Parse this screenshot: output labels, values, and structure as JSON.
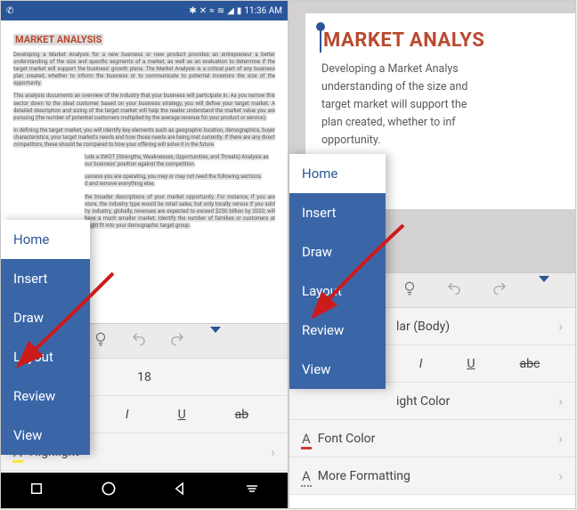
{
  "status": {
    "time": "11:36 AM",
    "phone_icon": "✆",
    "bt": "✱",
    "mute": "✕",
    "vib": "≈",
    "wifi": "≋",
    "signal": "◢",
    "batt": "▮"
  },
  "document": {
    "title": "MARKET ANALYSIS",
    "title_right": "MARKET ANALYS",
    "p1": "Developing a Market Analysis for a new business or new product provides an entrepreneur a better understanding of the size and specific segments of a market, as well as an evaluation to determine if the target market will support the business' growth plans. The Market Analysis is a critical part of any business plan created, whether to inform the business or to communicate to potential investors the size of the opportunity.",
    "p2": "This analysis documents an overview of the industry that your business will participate in. As you narrow this sector down to the ideal customer based on your business strategy, you will define your target market. A detailed description and sizing of the target market will help the reader understand the market value you are pursuing (the number of potential customers multiplied by the average revenue for your product or service).",
    "p3": "In defining the target market, you will identify key elements such as geographic location, demographics, buyer characteristics, your target market's needs and how those needs are being met currently. If there are any direct competitors, these should be compared to how your offering will solve it in the future.",
    "p4a": "lude a SWOT (Strengths, Weaknesses, Opportunities, and Threats) Analysis as",
    "p4b": "our business' position against the competition.",
    "p5a": "usiness you are operating, you may or may not need the following sections.",
    "p5b": "d and remove everything else.",
    "p6": "the broader descriptions of your market opportunity. For instance, if you are store, the industry type would be retail sales, but only locally versus if you sold lry industry, globally, revenues are expected to exceed $250 billion by 2020; will have a much smaller market. Identify the number of families or customers at might fit into your demographic target group.",
    "r_p1": "Developing a Market Analys",
    "r_p2": "understanding of the size and",
    "r_p3": "target market will support the",
    "r_p4": "plan created, whether to inf",
    "r_p5": "opportunity."
  },
  "menu": {
    "items": [
      {
        "label": "Home"
      },
      {
        "label": "Insert"
      },
      {
        "label": "Draw"
      },
      {
        "label": "Layout"
      },
      {
        "label": "Review"
      },
      {
        "label": "View"
      }
    ]
  },
  "format": {
    "font_size": "18",
    "italic": "I",
    "underline": "U",
    "strike": "ab",
    "strike_r": "abc",
    "highlight": "Highlight",
    "font_color": "Font Color",
    "more_formatting": "More Formatting",
    "body_label": "lar (Body)",
    "light_color": "ight Color"
  }
}
